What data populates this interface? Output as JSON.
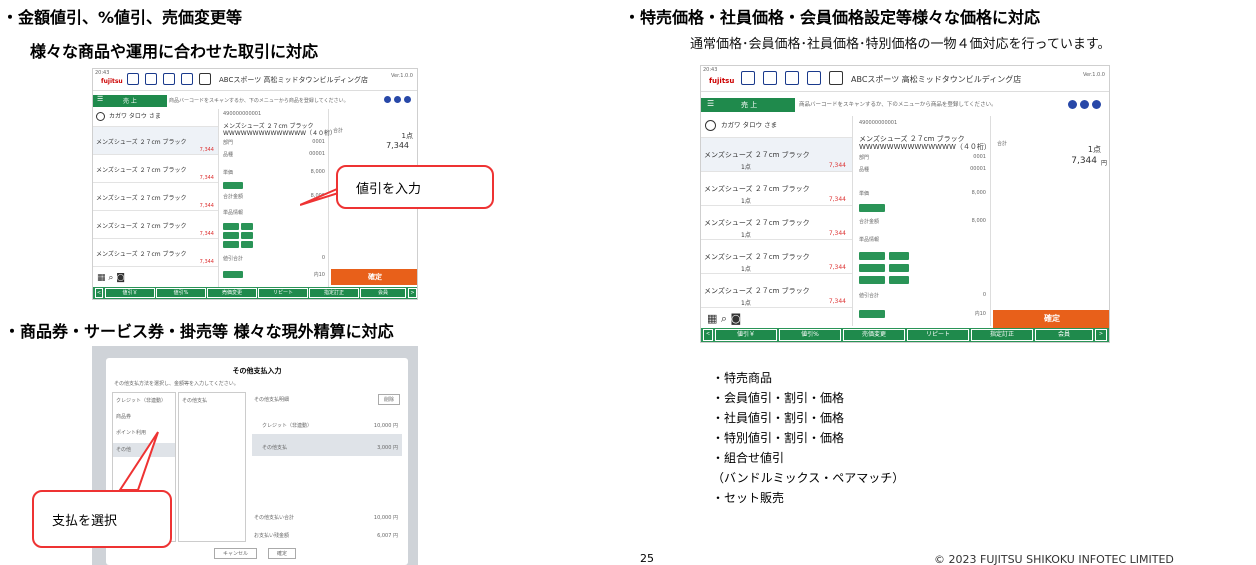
{
  "left": {
    "heading1": "・金額値引、%値引、売価変更等",
    "heading1b": "様々な商品や運用に合わせた取引に対応",
    "heading2": "・商品券・サービス券・掛売等 様々な現外精算に対応",
    "callout_discount": "値引を入力",
    "callout_payment": "支払を選択"
  },
  "right": {
    "heading": "・特売価格・社員価格・会員価格設定等様々な価格に対応",
    "subheading": "通常価格･会員価格･社員価格･特別価格の一物４価対応を行っています。",
    "features": [
      "・特売商品",
      "・会員値引・割引・価格",
      "・社員値引・割引・価格",
      "・特別値引・割引・価格",
      "・組合せ値引",
      "（バンドルミックス・ペアマッチ）",
      "・セット販売"
    ]
  },
  "pos": {
    "time": "20:43",
    "store": "ABCスポーツ 高松ミッドタウンビルディング店",
    "version": "Ver.1.0.0",
    "tab_sales": "売 上",
    "instruction": "商品バーコードをスキャンするか、下のメニューから商品を登録してください。",
    "customer": "カガワ タロウ さま",
    "item_name": "メンズシューズ ２７cm ブラック",
    "item_qty": "1点",
    "item_price": "7,344",
    "item_price_unit": "円",
    "item_code": "490000000001",
    "item_desc": "WWWWWWWWWWWWWW（４０桁）",
    "total_label": "合計",
    "total_qty": "1点",
    "total_amount": "7,344",
    "total_unit": "円",
    "field_dept": "部門",
    "field_dept_val": "0001",
    "field_item": "品種",
    "field_item_val": "00001",
    "field_unit_price": "単価",
    "field_unit_price_val": "8,000",
    "field_sum": "合計金額",
    "field_sum_val": "8,000",
    "field_info": "単品情報",
    "field_disc_total": "値引合計",
    "field_disc_total_val": "0",
    "confirm": "確定",
    "fkeys": [
      "値引￥",
      "値引%",
      "売価変更",
      "リピート",
      "指定訂正",
      "会員"
    ],
    "tax": "内10"
  },
  "dialog": {
    "title": "その他支払入力",
    "hint": "その他支払方法を選択し、金額等を入力してください。",
    "methods": [
      "クレジット（非連動）",
      "商品券",
      "ポイント利用",
      "その他"
    ],
    "col_title": "その他支払",
    "detail_title": "その他支払明細",
    "delete": "削除",
    "line1_label": "クレジット（非連動）",
    "line1_amount": "10,000 円",
    "line2_label": "その他支払",
    "line2_amount": "3,000 円",
    "sum_label": "その他支払い合計",
    "sum_amount": "10,000 円",
    "remain_label": "お支払い残金額",
    "remain_amount": "6,007 円",
    "cancel": "キャンセル",
    "ok": "確定"
  },
  "footer": {
    "page": "25",
    "copyright": "© 2023 FUJITSU SHIKOKU INFOTEC LIMITED"
  }
}
